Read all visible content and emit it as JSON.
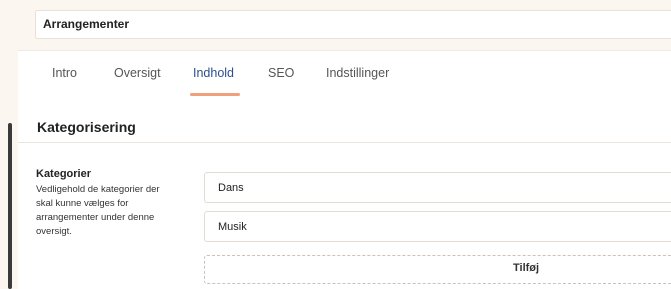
{
  "page_title": "Arrangementer",
  "tabs": [
    {
      "label": "Intro"
    },
    {
      "label": "Oversigt"
    },
    {
      "label": "Indhold",
      "active": true
    },
    {
      "label": "SEO"
    },
    {
      "label": "Indstillinger"
    }
  ],
  "section": {
    "title": "Kategorisering",
    "field": {
      "label": "Kategorier",
      "description": "Vedligehold de kategorier der skal kunne vælges for arrangementer under denne oversigt.",
      "items": [
        "Dans",
        "Musik"
      ],
      "add_label": "Tilføj"
    }
  },
  "colors": {
    "background": "#fbf6f0",
    "active_tab_text": "#2c4f8f",
    "active_tab_underline": "#f0a07a"
  }
}
